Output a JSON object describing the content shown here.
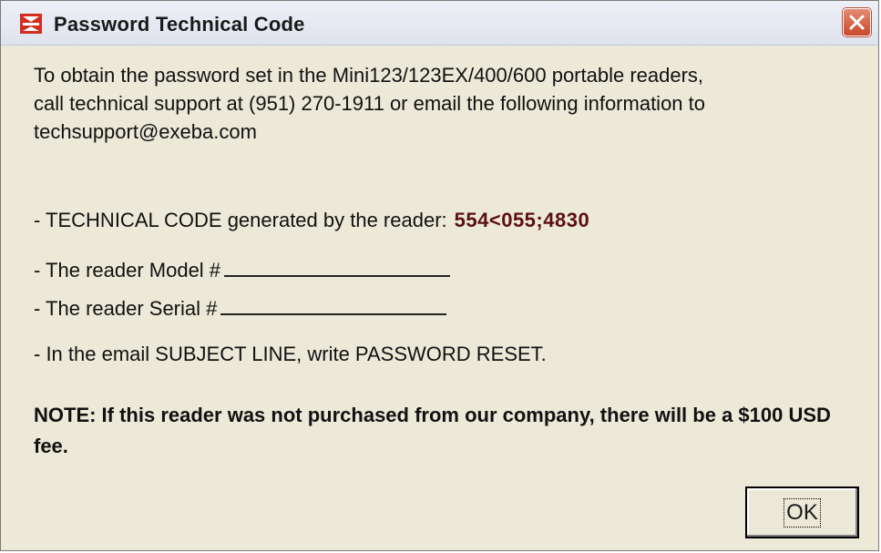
{
  "window": {
    "title": "Password Technical Code",
    "app_icon": "exeba-logo-icon",
    "close_icon": "close-icon",
    "colors": {
      "close_button": "#c9472c",
      "tech_code": "#5a1010"
    }
  },
  "content": {
    "intro": "To obtain the password set in the Mini123/123EX/400/600 portable readers,\ncall technical support at (951) 270-1911 or email the following information to\ntechsupport@exeba.com",
    "tech_code_label": "- TECHNICAL CODE generated by the reader:",
    "tech_code_value": "554<055;4830",
    "model_label": "- The reader Model #",
    "serial_label": "- The reader Serial #",
    "subject_line": "- In the email SUBJECT LINE, write PASSWORD RESET.",
    "note": "NOTE: If this reader was not purchased from our company, there will be a $100 USD fee."
  },
  "buttons": {
    "ok_label": "OK"
  }
}
